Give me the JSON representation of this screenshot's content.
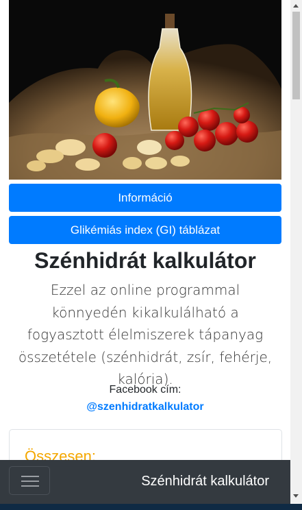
{
  "buttons": {
    "info": "Információ",
    "gi_table": "Glikémiás index (GI) táblázat"
  },
  "title": "Szénhidrát kalkulátor",
  "lead": "Ezzel az online programmal könnyedén kikalkulálható a fogyasztott élelmiszerek tápanyag összetétele (szénhidrát, zsír, fehérje, kalória).",
  "facebook": {
    "label": "Facebook cím:",
    "link": "@szenhidratkalkulator"
  },
  "card": {
    "heading": "Összesen:"
  },
  "navbar": {
    "brand": "Szénhidrát kalkulátor",
    "toggler_icon": "hamburger-menu-icon"
  },
  "hero_image": {
    "subject": "food-photo"
  },
  "colors": {
    "primary": "#007bff",
    "navbar": "#343a40",
    "heading_orange": "#f4a700"
  }
}
